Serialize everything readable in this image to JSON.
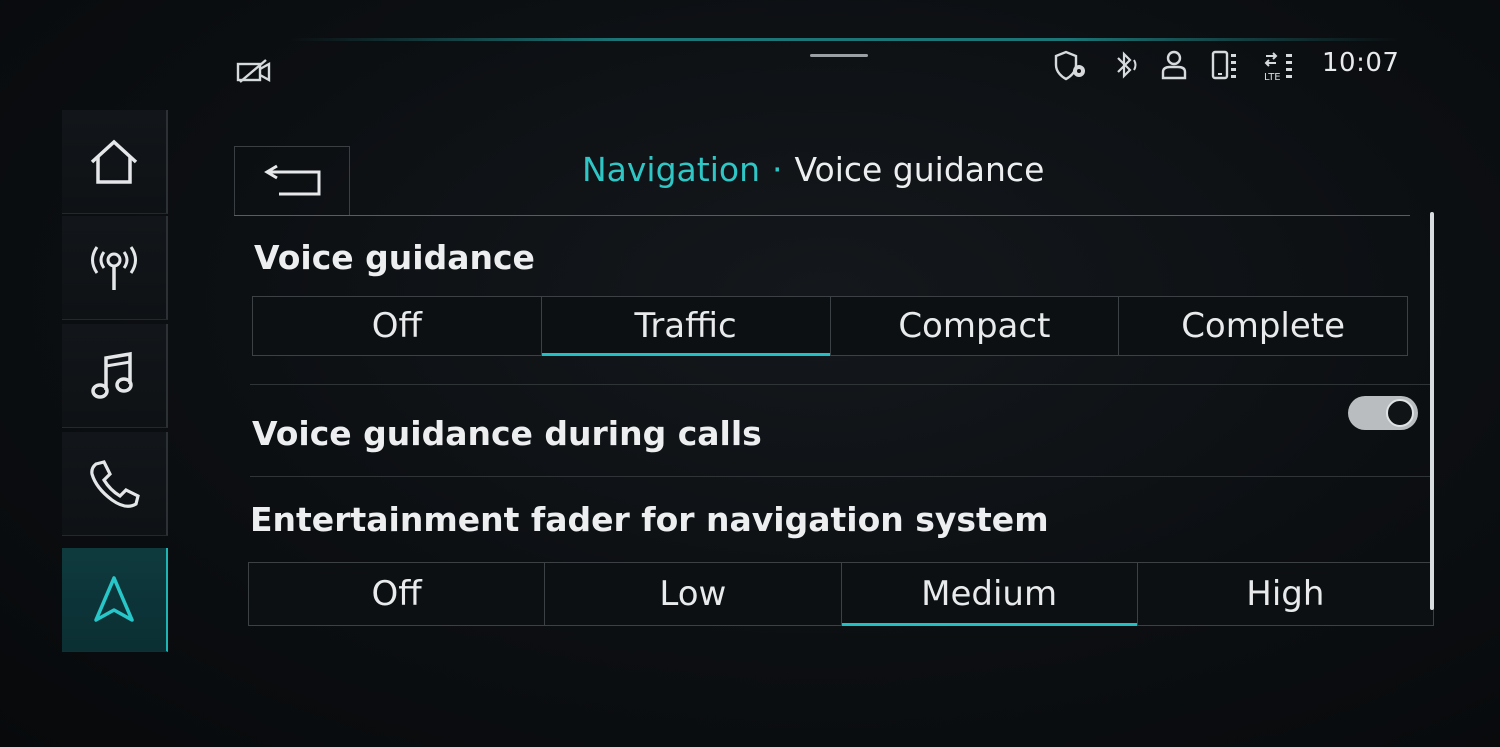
{
  "status_bar": {
    "time": "10:07",
    "icons": [
      "no-camera-icon",
      "location-shield-icon",
      "bluetooth-icon",
      "user-icon",
      "phone-battery-icon",
      "lte-signal-icon"
    ],
    "lte_label": "LTE"
  },
  "rail": {
    "items": [
      {
        "name": "home",
        "icon": "home-icon"
      },
      {
        "name": "radio",
        "icon": "antenna-icon"
      },
      {
        "name": "media",
        "icon": "music-note-icon"
      },
      {
        "name": "phone",
        "icon": "phone-icon"
      },
      {
        "name": "navigation",
        "icon": "navigation-arrow-icon",
        "active": true
      }
    ]
  },
  "header": {
    "parent": "Navigation",
    "separator": "·",
    "current": "Voice guidance"
  },
  "voice_guidance": {
    "title": "Voice guidance",
    "options": [
      "Off",
      "Traffic",
      "Compact",
      "Complete"
    ],
    "selected": "Traffic"
  },
  "calls": {
    "title": "Voice guidance during calls",
    "enabled": true
  },
  "fader": {
    "title": "Entertainment fader for navigation system",
    "options": [
      "Off",
      "Low",
      "Medium",
      "High"
    ],
    "selected": "Medium"
  },
  "colors": {
    "accent": "#22c0c4",
    "background": "#0c0f12",
    "text": "#e8eaeb"
  }
}
